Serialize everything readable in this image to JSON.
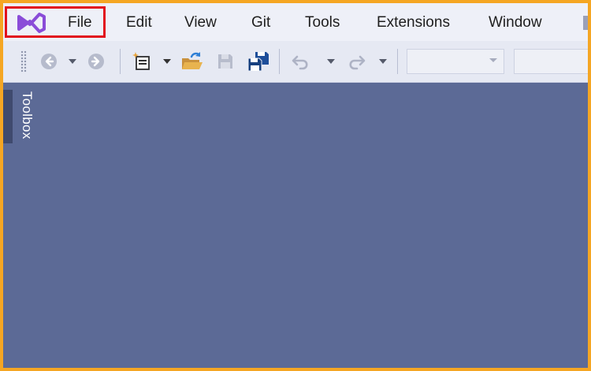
{
  "menu": {
    "items": [
      "File",
      "Edit",
      "View",
      "Git",
      "Tools",
      "Extensions",
      "Window"
    ],
    "highlighted": "File"
  },
  "toolbar": {
    "icons": [
      "grip-handle-icon",
      "navigate-back-icon",
      "dropdown-arrow-icon",
      "navigate-forward-icon",
      "new-project-icon",
      "dropdown-arrow-icon",
      "open-file-icon",
      "save-icon",
      "save-all-icon",
      "undo-icon",
      "dropdown-arrow-icon",
      "redo-icon",
      "dropdown-arrow-icon"
    ],
    "configuration_combo": "",
    "platform_combo": ""
  },
  "side_panel": {
    "toolbox_label": "Toolbox"
  },
  "colors": {
    "outer_border": "#f5a623",
    "highlight": "#e2101c",
    "workspace": "#5c6a96",
    "logo": "#8a4cd8"
  }
}
